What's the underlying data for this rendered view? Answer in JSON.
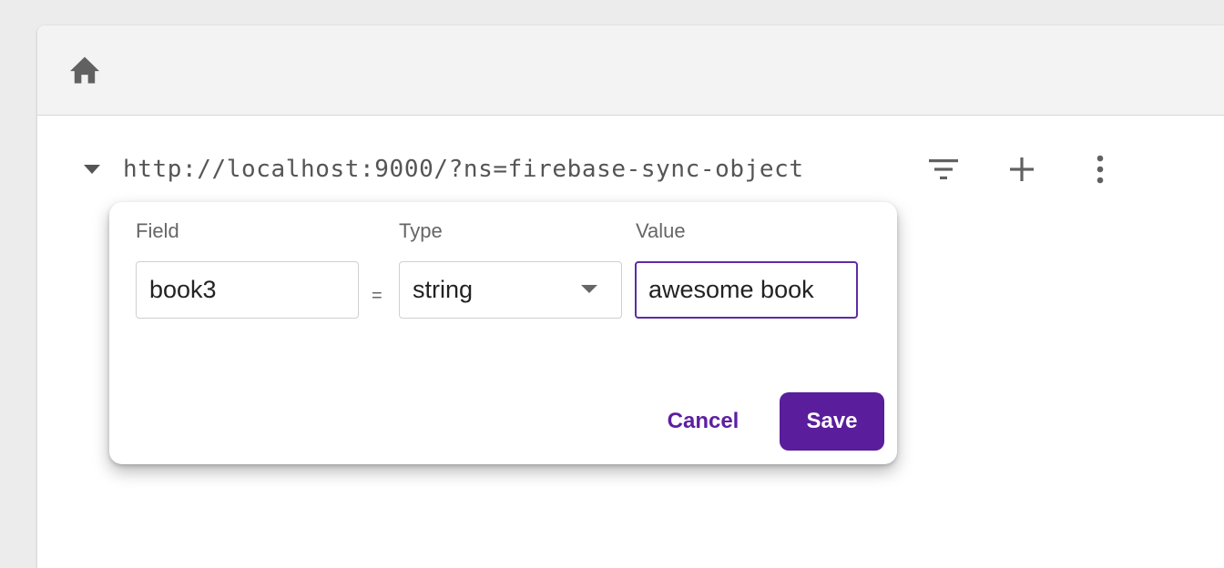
{
  "toolbar": {
    "home_icon": "home-icon"
  },
  "tree": {
    "url": "http://localhost:9000/?ns=firebase-sync-object",
    "icons": {
      "expand": "arrow-drop-down-icon",
      "filter": "filter-icon",
      "add": "add-icon",
      "more": "more-vertical-icon"
    }
  },
  "dialog": {
    "field_label": "Field",
    "type_label": "Type",
    "value_label": "Value",
    "field_value": "book3",
    "equals": "=",
    "type_value": "string",
    "value_value": "awesome book",
    "cancel_label": "Cancel",
    "save_label": "Save"
  },
  "colors": {
    "accent": "#5a1d9c",
    "background": "#ececec",
    "toolbar": "#f3f3f3",
    "icon": "#616161"
  }
}
